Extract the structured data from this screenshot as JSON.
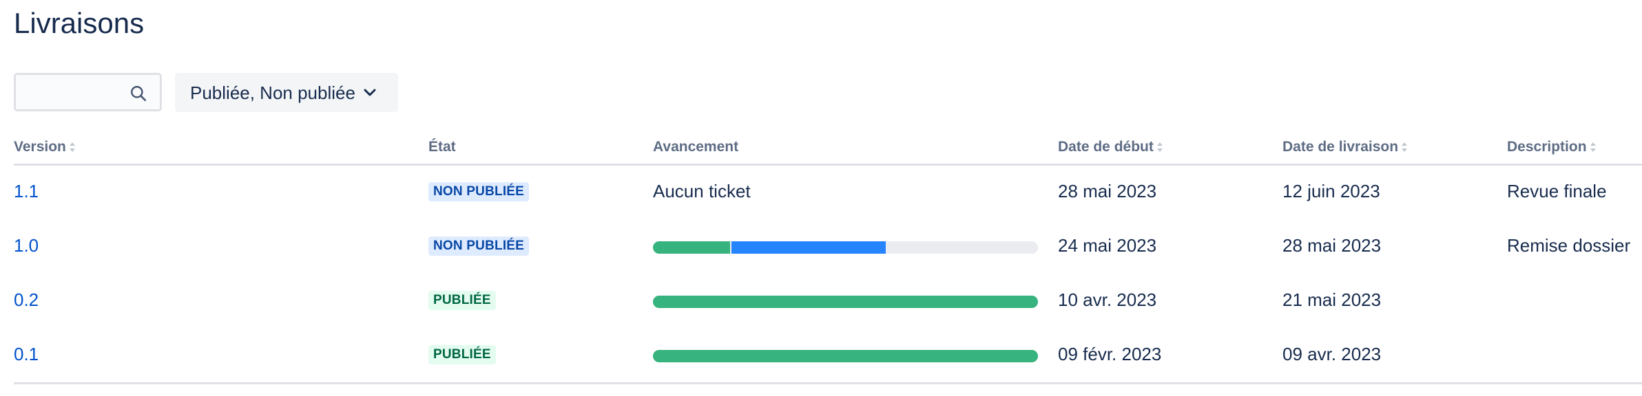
{
  "page": {
    "title": "Livraisons"
  },
  "toolbar": {
    "search_value": "",
    "search_placeholder": "",
    "filter_label": "Publiée, Non publiée"
  },
  "columns": {
    "version": "Version",
    "state": "État",
    "progress": "Avancement",
    "start_date": "Date de début",
    "release_date": "Date de livraison",
    "description": "Description"
  },
  "colors": {
    "link": "#0052cc",
    "done": "#36b37e",
    "in_progress": "#2684ff",
    "todo": "#ebecf0",
    "unreleased_bg": "#deebff",
    "unreleased_text": "#0747a6",
    "released_bg": "#e3fcef",
    "released_text": "#006644"
  },
  "rows": [
    {
      "version": "1.1",
      "state": "NON PUBLIÉE",
      "status": "unreleased",
      "progress_text": "Aucun ticket",
      "progress": null,
      "start_date": "28 mai 2023",
      "release_date": "12 juin 2023",
      "description": "Revue finale"
    },
    {
      "version": "1.0",
      "state": "NON PUBLIÉE",
      "status": "unreleased",
      "progress_text": "",
      "progress": {
        "done": 0.2,
        "in_progress": 0.4,
        "todo": 0.4
      },
      "start_date": "24 mai 2023",
      "release_date": "28 mai 2023",
      "description": "Remise dossier"
    },
    {
      "version": "0.2",
      "state": "PUBLIÉE",
      "status": "released",
      "progress_text": "",
      "progress": {
        "done": 1.0,
        "in_progress": 0,
        "todo": 0
      },
      "start_date": "10 avr. 2023",
      "release_date": "21 mai 2023",
      "description": ""
    },
    {
      "version": "0.1",
      "state": "PUBLIÉE",
      "status": "released",
      "progress_text": "",
      "progress": {
        "done": 1.0,
        "in_progress": 0,
        "todo": 0
      },
      "start_date": "09 févr. 2023",
      "release_date": "09 avr. 2023",
      "description": ""
    }
  ]
}
